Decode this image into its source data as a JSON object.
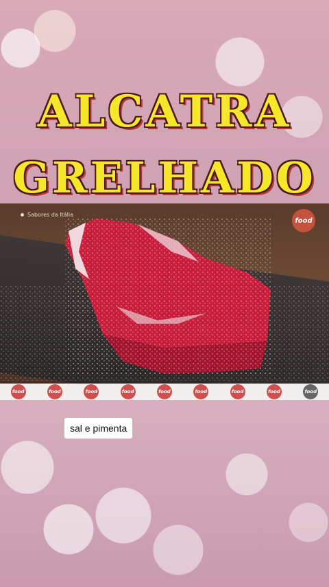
{
  "title": {
    "line1": "ALCATRA",
    "line2": "GRELHADO"
  },
  "video": {
    "watermark_text": "Sabores da Itália",
    "logo_text": "food"
  },
  "strip": {
    "logo_text": "food",
    "logo_count": 9
  },
  "caption": "sal e pimenta",
  "colors": {
    "title_fill": "#f7e72a",
    "title_outline": "#4a1a1a",
    "meat": "#c81e3c",
    "board": "#3d3636",
    "logo_bg": "#cf4e4e"
  }
}
